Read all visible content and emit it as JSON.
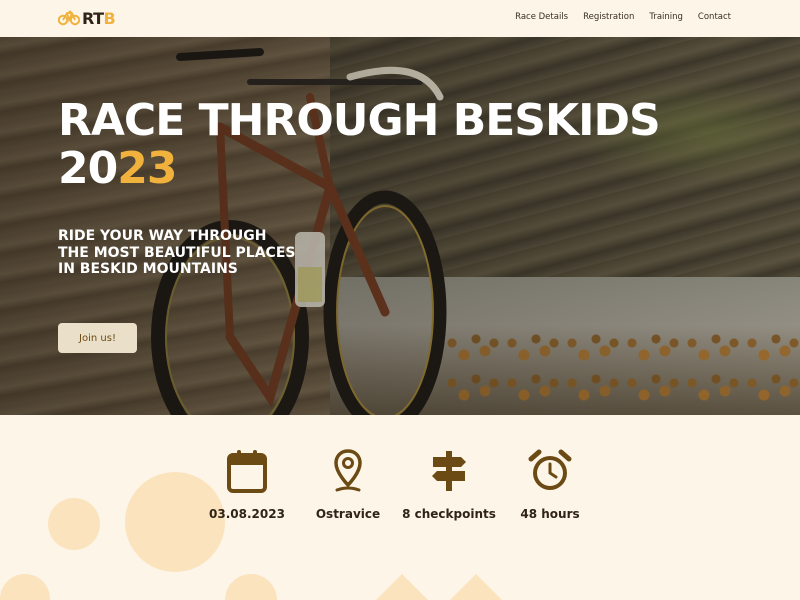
{
  "header": {
    "logo": {
      "r": "RT",
      "b": "B"
    },
    "nav": [
      "Race Details",
      "Registration",
      "Training",
      "Contact"
    ]
  },
  "hero": {
    "title_line1": "RACE THROUGH BESKIDS",
    "year_a": "20",
    "year_b": "23",
    "subtitle_lines": [
      "RIDE YOUR WAY THROUGH",
      "THE MOST BEAUTIFUL PLACES",
      "IN BESKID MOUNTAINS"
    ],
    "cta_label": "Join us!"
  },
  "stats": [
    {
      "icon": "calendar-icon",
      "label": "03.08.2023"
    },
    {
      "icon": "location-pin-icon",
      "label": "Ostravice"
    },
    {
      "icon": "signpost-icon",
      "label": "8 checkpoints"
    },
    {
      "icon": "alarm-clock-icon",
      "label": "48 hours"
    }
  ],
  "colors": {
    "background": "#fdf5e8",
    "accent": "#f0b23d",
    "icon": "#6b4a14",
    "decor": "#fbe3be"
  }
}
